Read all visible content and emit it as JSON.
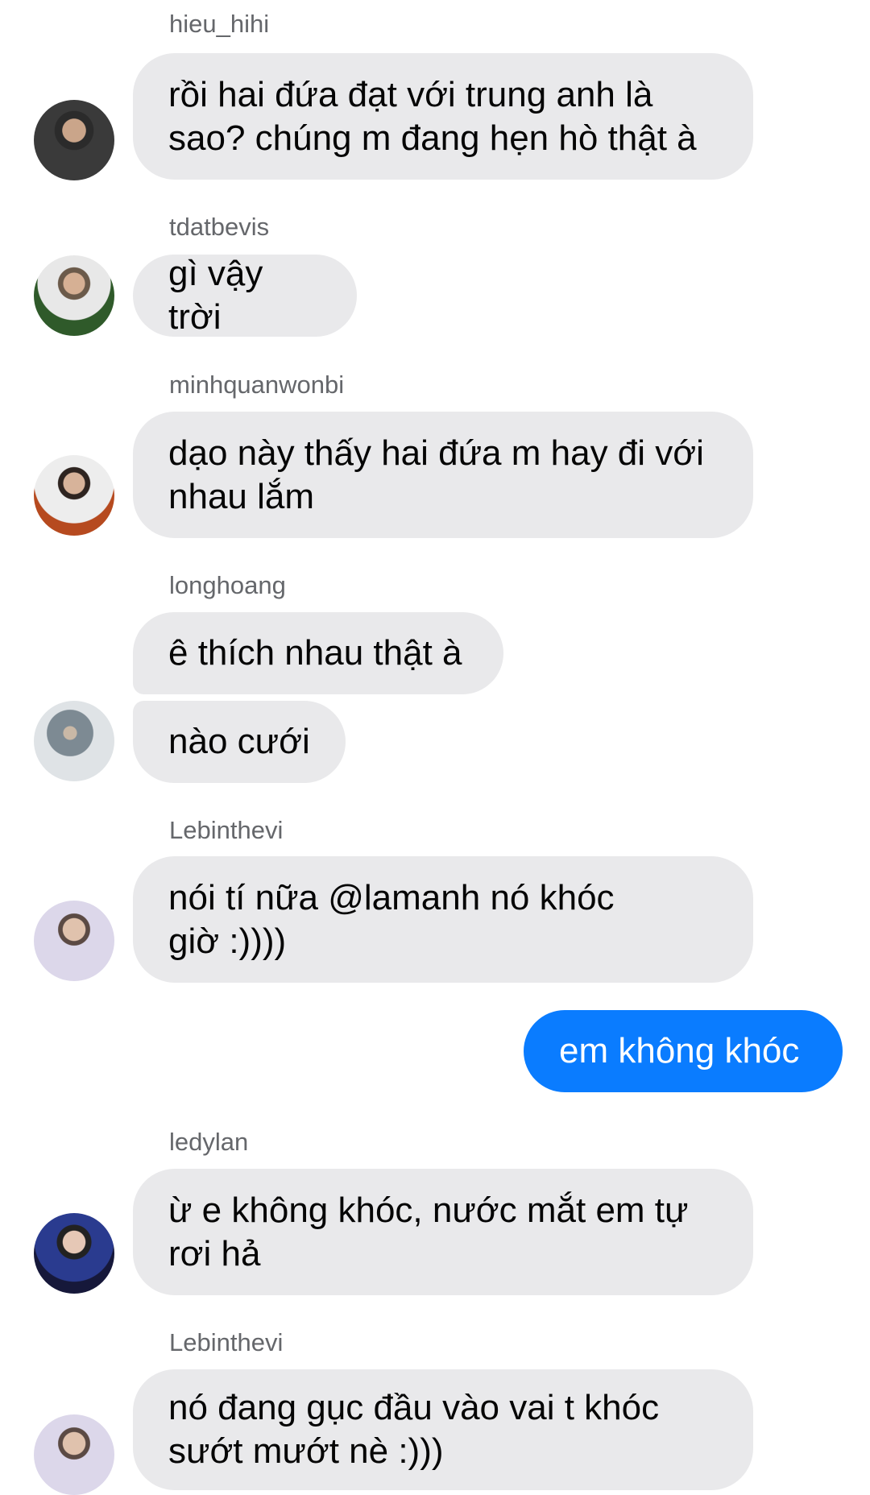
{
  "messages": [
    {
      "sender": "hieu_hihi",
      "lines": [
        "rồi hai đứa đạt với trung anh là",
        "sao? chúng m đang hẹn hò thật à"
      ]
    },
    {
      "sender": "tdatbevis",
      "lines": [
        "gì vậy trời"
      ]
    },
    {
      "sender": "minhquanwonbi",
      "lines": [
        "dạo này thấy hai đứa m hay đi với",
        "nhau lắm"
      ]
    },
    {
      "sender": "longhoang",
      "lines": [
        "ê thích nhau thật à"
      ],
      "second_lines": [
        "nào cưới"
      ]
    },
    {
      "sender": "Lebinthevi",
      "lines": [
        "nói tí nữa @lamanh nó khóc",
        "giờ :))))"
      ]
    },
    {
      "sender": "",
      "lines": [
        "em không khóc"
      ]
    },
    {
      "sender": "ledylan",
      "lines": [
        "ừ e không khóc, nước mắt em tự",
        "rơi hả"
      ]
    },
    {
      "sender": "Lebinthevi",
      "lines": [
        "nó đang gục đầu vào vai t khóc",
        "sướt mướt nè :)))"
      ]
    }
  ],
  "colors": {
    "incoming_bubble": "#e9e9eb",
    "outgoing_bubble": "#0a7cff",
    "sender_name": "#65676b"
  }
}
